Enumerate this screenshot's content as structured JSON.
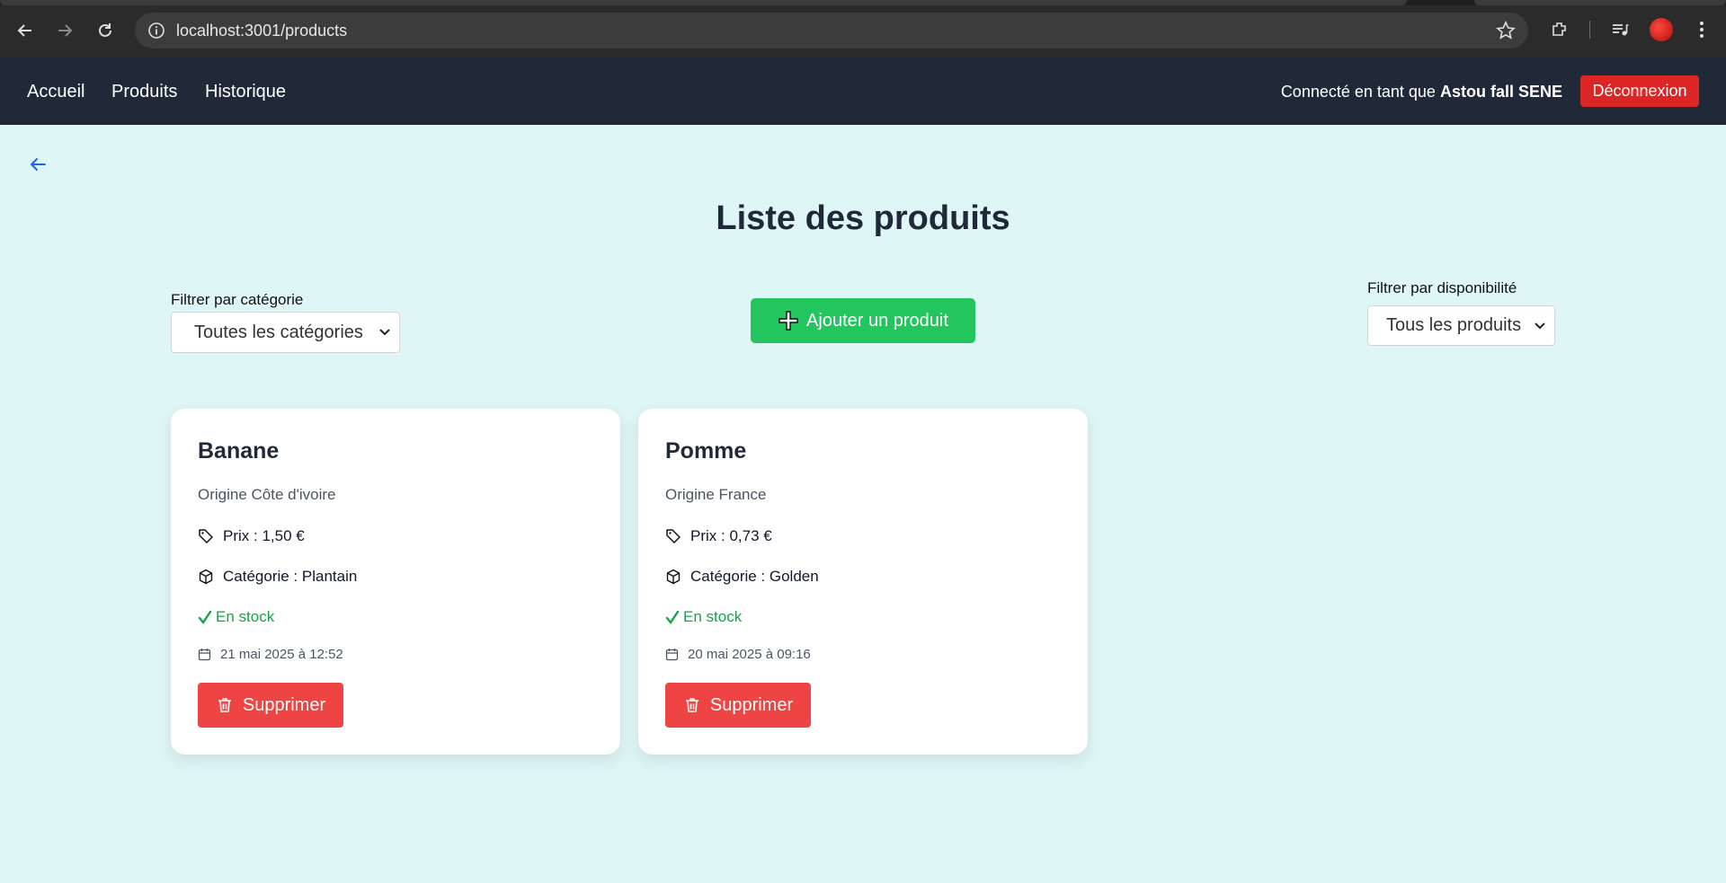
{
  "browser": {
    "url": "localhost:3001/products"
  },
  "navbar": {
    "links": [
      "Accueil",
      "Produits",
      "Historique"
    ],
    "user_prefix": "Connecté en tant que",
    "user_name": "Astou fall SENE",
    "logout_label": "Déconnexion"
  },
  "page": {
    "title": "Liste des produits"
  },
  "filters": {
    "category_label": "Filtrer par catégorie",
    "category_value": "Toutes les catégories",
    "availability_label": "Filtrer par disponibilité",
    "availability_value": "Tous les produits"
  },
  "add_button_label": "Ajouter un produit",
  "products": [
    {
      "name": "Banane",
      "origin": "Origine Côte d'ivoire",
      "price": "Prix : 1,50 €",
      "category": "Catégorie : Plantain",
      "stock": "En stock",
      "date": "21 mai 2025 à 12:52",
      "delete_label": "Supprimer"
    },
    {
      "name": "Pomme",
      "origin": "Origine France",
      "price": "Prix : 0,73 €",
      "category": "Catégorie : Golden",
      "stock": "En stock",
      "date": "20 mai 2025 à 09:16",
      "delete_label": "Supprimer"
    }
  ],
  "colors": {
    "navbar": "#1f2937",
    "background": "#dff6f7",
    "add_button": "#22c55e",
    "delete_button": "#ef4444",
    "logout_button": "#dc2626",
    "in_stock": "#16a34a"
  },
  "icons": {
    "back": "arrow-left-icon",
    "add": "plus-icon",
    "price": "tag-icon",
    "category": "box-icon",
    "stock": "check-icon",
    "date": "calendar-icon",
    "delete": "trash-icon"
  }
}
